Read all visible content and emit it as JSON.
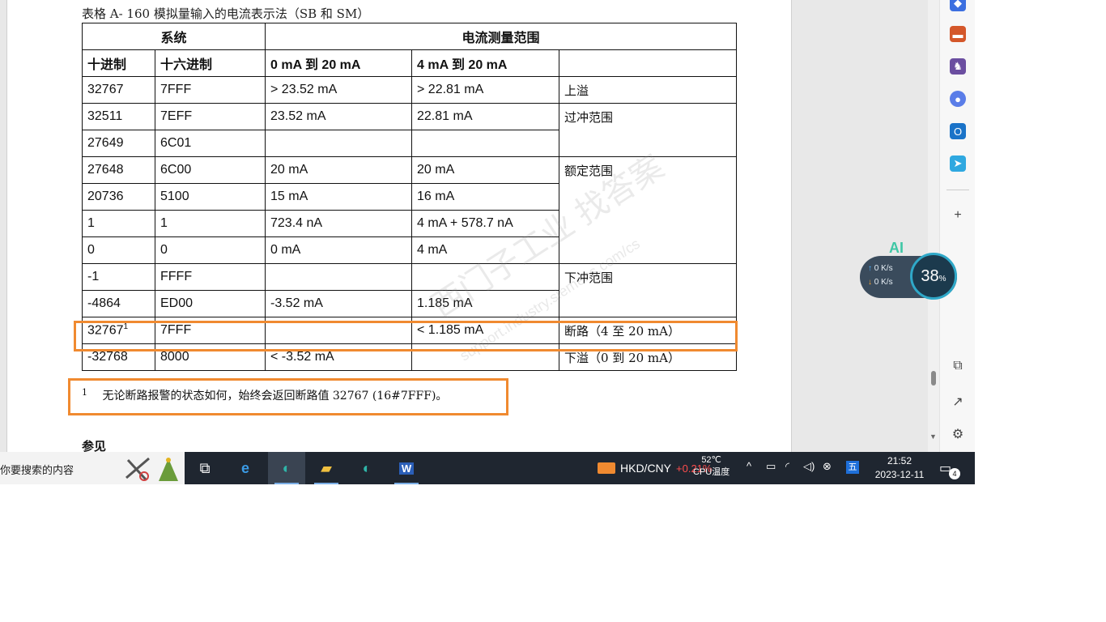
{
  "document": {
    "caption": "表格 A- 160 模拟量输入的电流表示法（SB 和 SM）",
    "table": {
      "group_headers": {
        "system": "系统",
        "range": "电流测量范围"
      },
      "columns": [
        "十进制",
        "十六进制",
        "0 mA 到 20 mA",
        "4 mA 到 20 mA"
      ],
      "rows": [
        {
          "dec": "32767",
          "hex": "7FFF",
          "c1": "> 23.52 mA",
          "c2": "> 22.81 mA"
        },
        {
          "dec": "32511",
          "hex": "7EFF",
          "c1": "23.52 mA",
          "c2": "22.81 mA"
        },
        {
          "dec": "27649",
          "hex": "6C01",
          "c1": "",
          "c2": ""
        },
        {
          "dec": "27648",
          "hex": "6C00",
          "c1": "20 mA",
          "c2": "20 mA"
        },
        {
          "dec": "20736",
          "hex": "5100",
          "c1": "15 mA",
          "c2": "16 mA"
        },
        {
          "dec": "1",
          "hex": "1",
          "c1": "723.4 nA",
          "c2": "4 mA + 578.7 nA"
        },
        {
          "dec": "0",
          "hex": "0",
          "c1": "0 mA",
          "c2": "4 mA"
        },
        {
          "dec": "-1",
          "hex": "FFFF",
          "c1": "",
          "c2": ""
        },
        {
          "dec": "-4864",
          "hex": "ED00",
          "c1": "-3.52 mA",
          "c2": "1.185 mA"
        },
        {
          "dec": "32767",
          "dec_sup": "1",
          "hex": "7FFF",
          "c1": "",
          "c2": "< 1.185 mA"
        },
        {
          "dec": "-32768",
          "hex": "8000",
          "c1": "< -3.52 mA",
          "c2": ""
        }
      ],
      "ranges": {
        "overflow": "上溢",
        "overshoot": "过冲范围",
        "rated": "额定范围",
        "undershoot": "下冲范围",
        "wire_break": "断路（4 至 20 mA）",
        "underflow": "下溢（0 到 20 mA）"
      }
    },
    "footnote": {
      "mark": "1",
      "text": "无论断路报警的状态如何，始终会返回断路值 32767 (16#7FFF)。"
    },
    "next_heading": "参见",
    "watermark": "西门子工业 找答案",
    "watermark_url": "support.industry.siemens.com/cs"
  },
  "sidebar": {
    "icons": [
      "gem-icon",
      "toolbox-icon",
      "chess-icon",
      "copilot-icon",
      "outlook-icon",
      "send-icon"
    ],
    "add_label": "+",
    "bottom_icons": [
      "screenshot-icon",
      "external-link-icon",
      "settings-icon"
    ]
  },
  "netwidget": {
    "ai_label": "AI",
    "up_arrow": "↑",
    "down_arrow": "↓",
    "up": "0 K/s",
    "down": "0 K/s",
    "cpu_percent": "38",
    "cpu_unit": "%"
  },
  "taskbar": {
    "search_text": "你要搜索的内容",
    "apps": [
      "task-view-icon",
      "ie-icon",
      "edge-icon",
      "file-explorer-icon",
      "edge-icon",
      "word-icon"
    ],
    "currency_label": "HKD/CNY",
    "currency_change": "+0.21%",
    "cpu_temp": "52℃",
    "cpu_temp_label": "CPU温度",
    "ime_label": "五",
    "time": "21:52",
    "date": "2023-12-11",
    "notif_count": "4",
    "accent_color": "#f08a30"
  }
}
